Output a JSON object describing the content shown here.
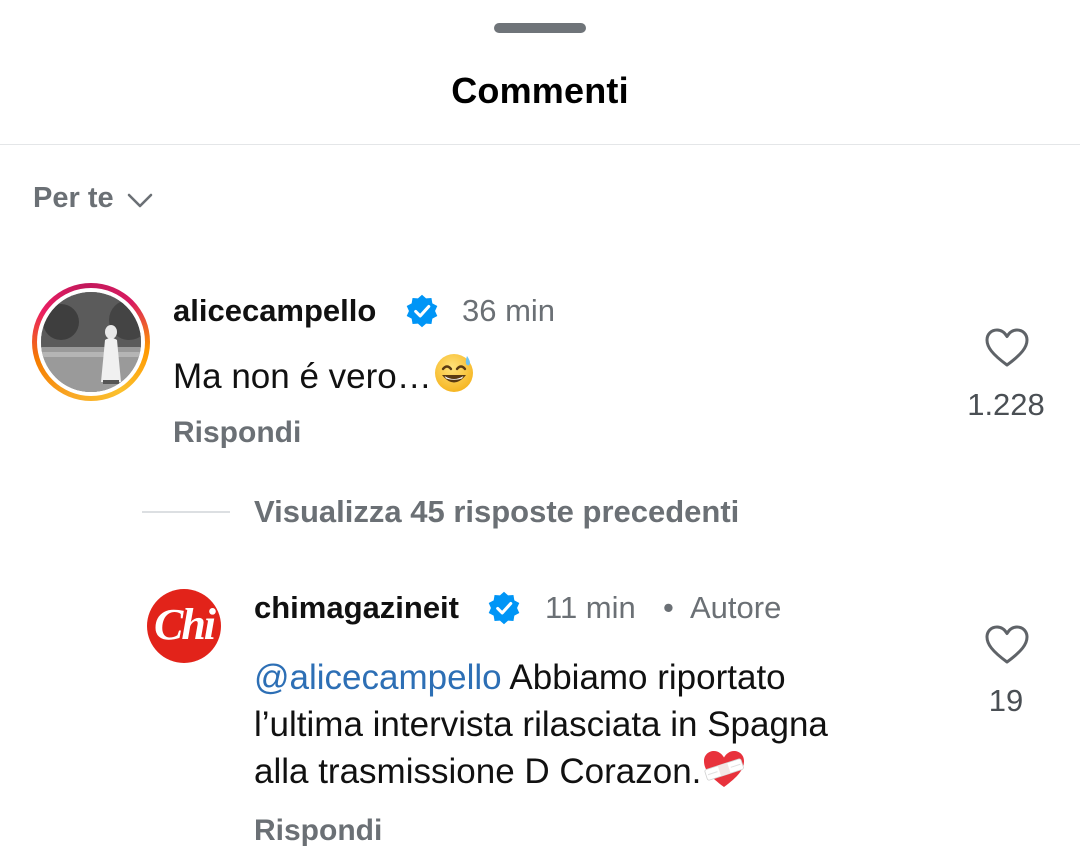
{
  "header": {
    "title": "Commenti"
  },
  "sort": {
    "label": "Per te"
  },
  "comments": [
    {
      "username": "alicecampello",
      "verified": true,
      "time": "36 min",
      "text": "Ma non é vero…",
      "emoji": "sweat-smile-emoji",
      "reply_label": "Rispondi",
      "likes": "1.228"
    }
  ],
  "view_replies": {
    "label": "Visualizza 45 risposte precedenti"
  },
  "replies": [
    {
      "username": "chimagazineit",
      "avatar_text": "Chi",
      "verified": true,
      "time": "11 min",
      "separator": "•",
      "author_badge": "Autore",
      "mention": "@alicecampello",
      "text_line1": " Abbiamo riportato",
      "text_line2": "l’ultima intervista rilasciata in Spagna",
      "text_line3": "alla trasmissione D Corazon.",
      "emoji": "heart-bandage-emoji",
      "reply_label": "Rispondi",
      "likes": "19"
    }
  ],
  "colors": {
    "verified": "#0095f6",
    "mention": "#2d6fb5",
    "secondary_text": "#6b7075",
    "chi_red": "#e2231a"
  }
}
